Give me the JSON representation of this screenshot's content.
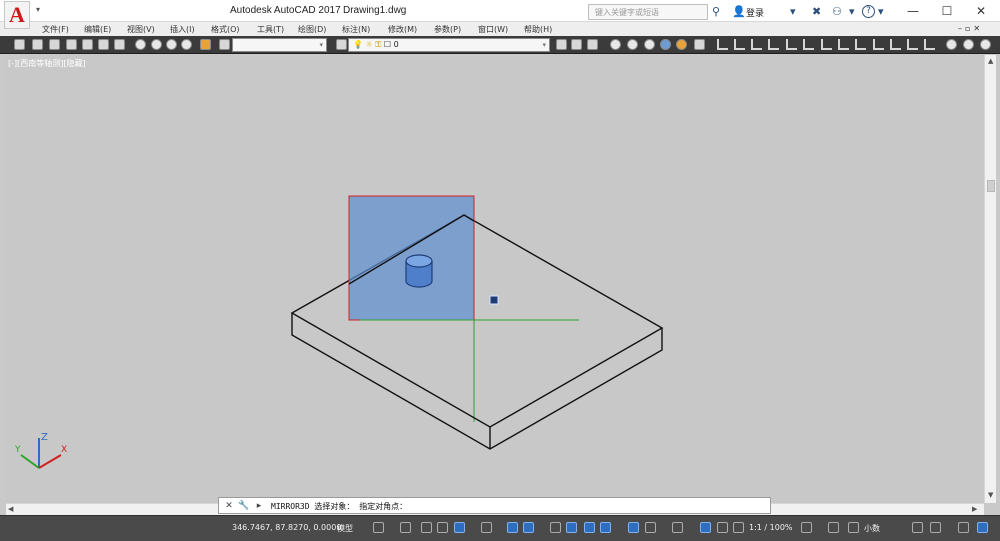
{
  "titlebar": {
    "app_title": "Autodesk AutoCAD 2017",
    "doc_title": "Drawing1.dwg",
    "logo_letter": "A",
    "search_placeholder": "键入关键字或短语",
    "login_label": "登录",
    "help_label": "?",
    "minimize": "—",
    "maximize": "☐",
    "close": "✕"
  },
  "menubar": {
    "items": [
      "文件(F)",
      "编辑(E)",
      "视图(V)",
      "插入(I)",
      "格式(O)",
      "工具(T)",
      "绘图(D)",
      "标注(N)",
      "修改(M)",
      "参数(P)",
      "窗口(W)",
      "帮助(H)"
    ]
  },
  "toolbar": {
    "layer_value": "0",
    "workspace_value": ""
  },
  "drawing": {
    "view_label": "[-][西南等轴测][隐藏]",
    "right_controls": "_ ☐ ✕"
  },
  "ucs": {
    "x_label": "X",
    "y_label": "Y",
    "z_label": "Z"
  },
  "cmdline": {
    "command": "MIRROR3D",
    "prompt": "选择对象：",
    "sub_prompt": "指定对角点："
  },
  "statusbar": {
    "coordinates": "346.7467, 87.8270, 0.0000",
    "model_label": "模型",
    "scale": "1:1 / 100%",
    "units": "小数"
  },
  "colors": {
    "viewport_bg": "#c8c8c8",
    "selection_fill": "#5f8fd0",
    "selection_border": "#d22020",
    "ucs_green": "#2aa52a",
    "toolbar_bg": "#3b3b3b",
    "statusbar_bg": "#4a4a4a"
  }
}
